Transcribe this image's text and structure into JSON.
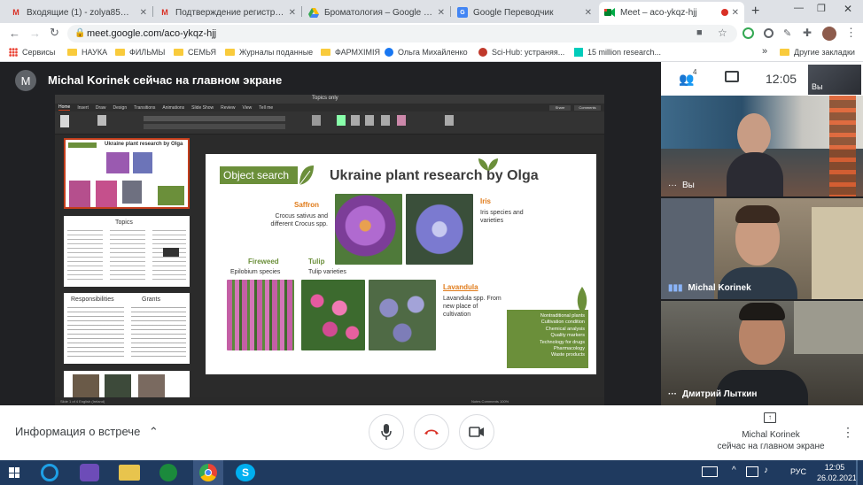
{
  "browser": {
    "tabs": [
      {
        "label": "Входящие (1) - zolya85@gmail.",
        "icon": "gmail-icon"
      },
      {
        "label": "Подтверждение регистрации ·",
        "icon": "gmail-icon"
      },
      {
        "label": "Броматология – Google Диск",
        "icon": "google-drive-icon"
      },
      {
        "label": "Google Переводчик",
        "icon": "google-translate-icon"
      },
      {
        "label": "Meet – aco-ykqz-hjj",
        "icon": "google-meet-icon"
      }
    ],
    "url": "meet.google.com/aco-ykqz-hjj",
    "bookmarks": [
      "Сервисы",
      "НАУКА",
      "ФИЛЬМЫ",
      "СЕМЬЯ",
      "Журналы поданные",
      "ФАРМХІМІЯ",
      "Ольга Михайленко",
      "Sci-Hub: устраняя...",
      "15 million research..."
    ],
    "bookmarks_more": "»",
    "other_bookmarks": "Другие закладки"
  },
  "meet": {
    "presenter_initial": "M",
    "presenting_banner": "Michal Korinek сейчас на главном экране",
    "participants_count": "4",
    "time": "12:05",
    "self_label": "Вы",
    "tiles": [
      {
        "name": "Вы"
      },
      {
        "name": "Michal Korinek"
      },
      {
        "name": "Дмитрий Лыткин"
      }
    ],
    "meeting_info": "Информация о встрече",
    "presenting_footer_line1": "Michal Korinek",
    "presenting_footer_line2": "сейчас на главном экране"
  },
  "ppt": {
    "title": "Topics only",
    "ribbon_tabs": [
      "Home",
      "Insert",
      "Draw",
      "Design",
      "Transitions",
      "Animations",
      "Slide Show",
      "Review",
      "View",
      "Tell me"
    ],
    "share": "Share",
    "comments": "Comments",
    "status_left": "Slide 1 of 4    English (Ireland)",
    "status_right": "Notes    Comments    100%",
    "thumb2_title": "Topics",
    "thumb3_col1": "Responsibilities",
    "thumb3_col2": "Grants"
  },
  "slide": {
    "object_search": "Object search",
    "title": "Ukraine plant research by Olga",
    "saffron_name": "Saffron",
    "saffron_desc": "Crocus sativus and different Crocus spp.",
    "iris_name": "Iris",
    "iris_desc": "Iris species and varieties",
    "fireweed_name": "Fireweed",
    "fireweed_desc": "Epilobium species",
    "tulip_name": "Tulip",
    "tulip_desc": "Tulip varieties",
    "lavandula_name": "Lavandula",
    "lavandula_desc": "Lavandula spp. From new place of cultivation",
    "green_box": [
      "Nontraditional plants",
      "Cultivation condition",
      "Chemical analysis",
      "Quality markers",
      "Technology for drugs",
      "Pharmacology",
      "Waste products"
    ]
  },
  "taskbar": {
    "language": "РУС",
    "time": "12:05",
    "date": "26.02.2021"
  },
  "colors": {
    "slide_green": "#6b8f3a",
    "saffron_orange": "#e07b1a",
    "meet_bg": "#202124"
  }
}
